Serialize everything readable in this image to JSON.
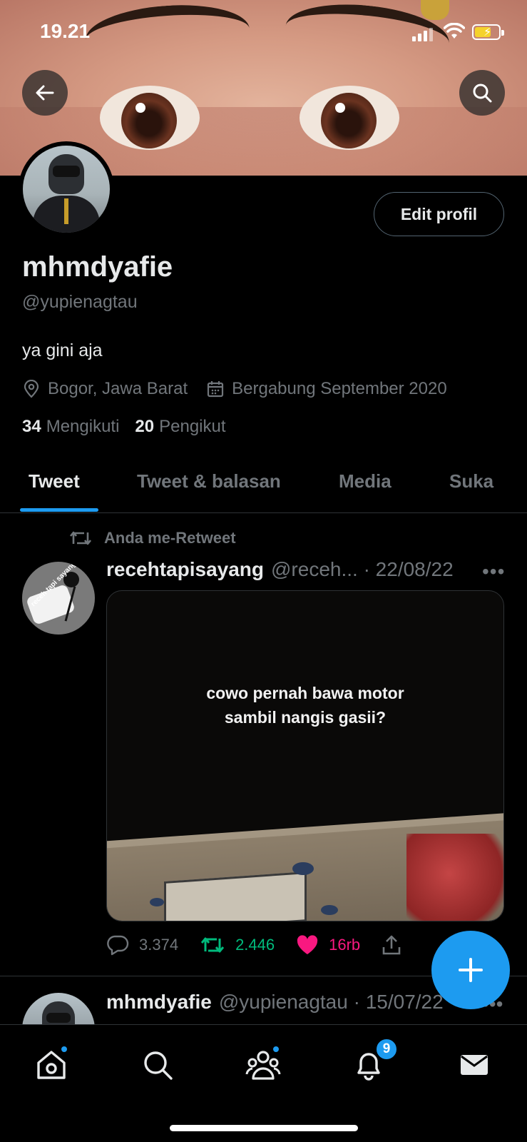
{
  "status_bar": {
    "time": "19.21"
  },
  "profile": {
    "name": "mhmdyafie",
    "handle": "@yupienagtau",
    "bio": "ya gini aja",
    "location": "Bogor, Jawa Barat",
    "joined": "Bergabung September 2020",
    "following_count": "34",
    "following_label": "Mengikuti",
    "followers_count": "20",
    "followers_label": "Pengikut",
    "edit_label": "Edit profil"
  },
  "tabs": [
    {
      "label": "Tweet",
      "active": true
    },
    {
      "label": "Tweet & balasan",
      "active": false
    },
    {
      "label": "Media",
      "active": false
    },
    {
      "label": "Suka",
      "active": false
    }
  ],
  "tweets": [
    {
      "retweet_note": "Anda me-Retweet",
      "name": "recehtapisayang",
      "handle_date": "@receh... · 22/08/22",
      "avatar_label": "receh tapi sayang",
      "media_text": "cowo pernah bawa motor sambil nangis gasii?",
      "replies": "3.374",
      "retweets": "2.446",
      "likes": "16rb"
    },
    {
      "name": "mhmdyafie",
      "handle_date": "@yupienagtau · 15/07/22"
    }
  ],
  "nav": {
    "notifications_badge": "9"
  },
  "colors": {
    "accent": "#1d9bf0",
    "retweet": "#00ba7c",
    "like": "#f91880",
    "muted": "#71767b"
  }
}
